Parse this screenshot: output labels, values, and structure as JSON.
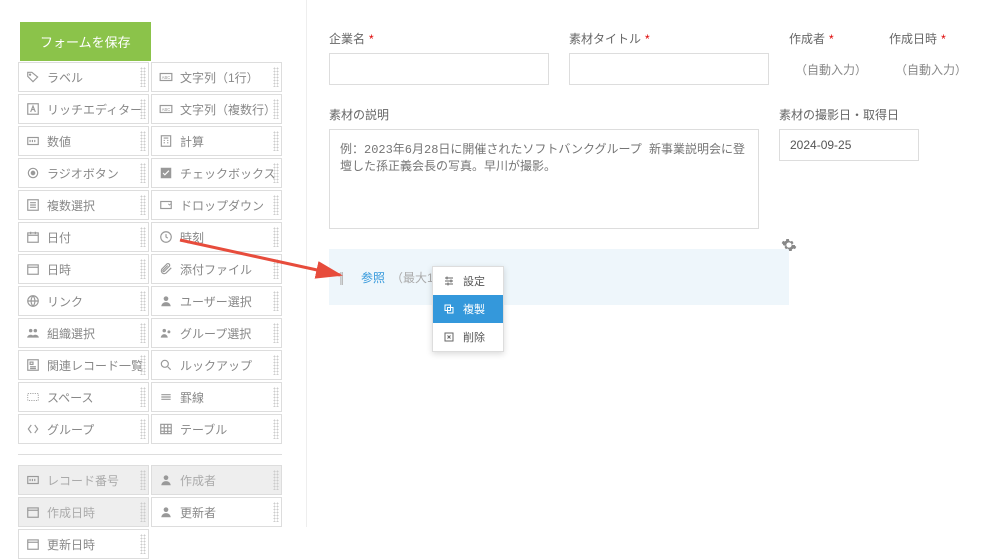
{
  "save_button": "フォームを保存",
  "palette": {
    "left": [
      "ラベル",
      "リッチエディター",
      "数値",
      "ラジオボタン",
      "複数選択",
      "日付",
      "日時",
      "リンク",
      "組織選択",
      "関連レコード一覧",
      "スペース",
      "グループ"
    ],
    "right": [
      "文字列（1行）",
      "文字列（複数行）",
      "計算",
      "チェックボックス",
      "ドロップダウン",
      "時刻",
      "添付ファイル",
      "ユーザー選択",
      "グループ選択",
      "ルックアップ",
      "罫線",
      "テーブル"
    ],
    "bottom_left": [
      "レコード番号",
      "作成日時",
      "更新日時"
    ],
    "bottom_right": [
      "作成者",
      "更新者"
    ]
  },
  "canvas": {
    "company_label": "企業名",
    "title_label": "素材タイトル",
    "creator_label": "作成者",
    "created_at_label": "作成日時",
    "auto_input": "（自動入力）",
    "desc_label": "素材の説明",
    "desc_placeholder": "例：2023年6月28日に開催されたソフトバンクグループ 新事業説明会に登壇した孫正義会長の写真。早川が撮影。",
    "shoot_date_label": "素材の撮影日・取得日",
    "shoot_date_value": "2024-09-25",
    "attach_link": "参照",
    "attach_note": "（最大1"
  },
  "popup": {
    "settings": "設定",
    "duplicate": "複製",
    "delete": "削除"
  }
}
